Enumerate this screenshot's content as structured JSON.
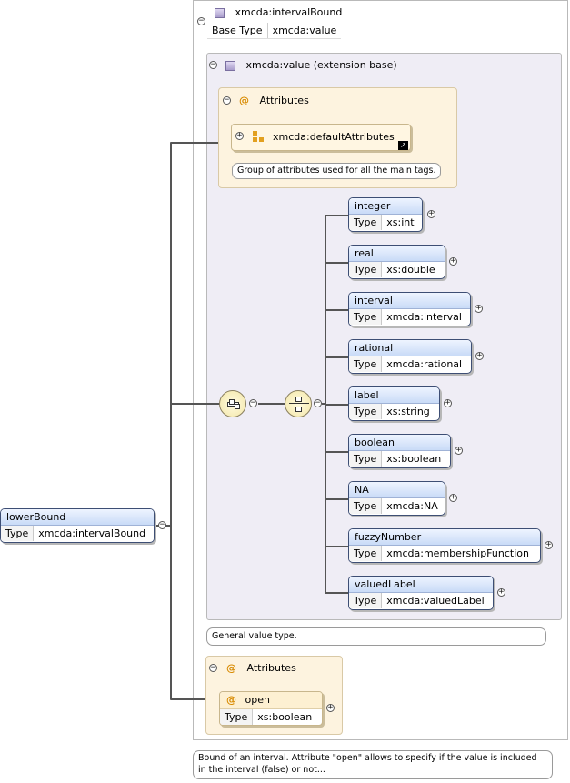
{
  "complex_type": {
    "name": "xmcda:intervalBound",
    "base_type_label": "Base Type",
    "base_type_value": "xmcda:value"
  },
  "extension": {
    "label": "xmcda:value (extension base)",
    "attributes_label": "Attributes",
    "group_ref": "xmcda:defaultAttributes",
    "group_annotation": "Group of attributes used for all the main tags.",
    "annotation": "General value type."
  },
  "type_label": "Type",
  "choice_elements": [
    {
      "name": "integer",
      "type": "xs:int"
    },
    {
      "name": "real",
      "type": "xs:double"
    },
    {
      "name": "interval",
      "type": "xmcda:interval"
    },
    {
      "name": "rational",
      "type": "xmcda:rational"
    },
    {
      "name": "label",
      "type": "xs:string"
    },
    {
      "name": "boolean",
      "type": "xs:boolean"
    },
    {
      "name": "NA",
      "type": "xmcda:NA"
    },
    {
      "name": "fuzzyNumber",
      "type": "xmcda:membershipFunction"
    },
    {
      "name": "valuedLabel",
      "type": "xmcda:valuedLabel"
    }
  ],
  "own_attributes": {
    "label": "Attributes",
    "attribute_name": "open",
    "attribute_type": "xs:boolean"
  },
  "root_element": {
    "name": "lowerBound",
    "type": "xmcda:intervalBound"
  },
  "root_annotation": "Bound of an interval. Attribute \"open\" allows to specify if the value is included in the interval (false) or not...",
  "icons": {
    "sequence": "sequence-compositor-icon",
    "choice": "choice-compositor-icon",
    "type": "complex-type-icon",
    "attribute": "at-sign-icon",
    "group": "attribute-group-icon",
    "link": "link-arrow-icon",
    "collapse": "minus-toggle-icon",
    "expand": "plus-toggle-icon"
  }
}
